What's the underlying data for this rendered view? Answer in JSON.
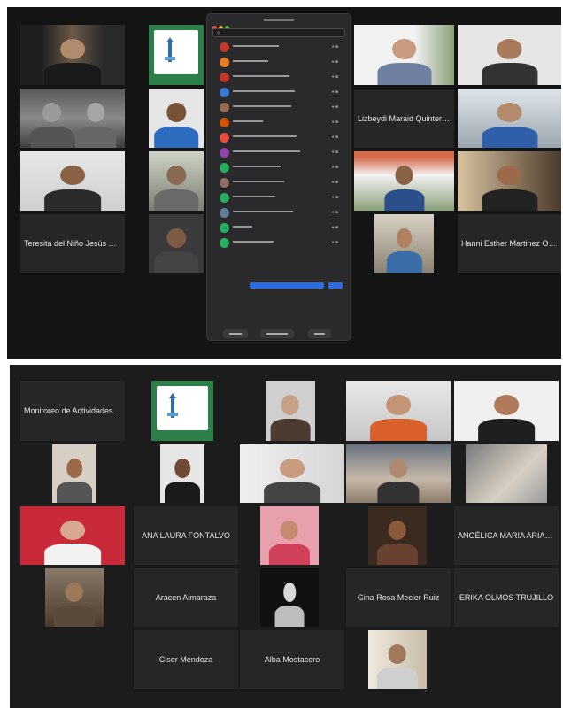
{
  "screenshot_top": {
    "panel": {
      "rows": [
        {
          "avatar_color": "#c0392b"
        },
        {
          "avatar_color": "#e67e22"
        },
        {
          "avatar_color": "#c0392b"
        },
        {
          "avatar_color": "#3a7bd5"
        },
        {
          "avatar_color": "#9b6b4e"
        },
        {
          "avatar_color": "#d35400"
        },
        {
          "avatar_color": "#e74c3c"
        },
        {
          "avatar_color": "#8e44ad"
        },
        {
          "avatar_color": "#27ae60"
        },
        {
          "avatar_color": "#8d6e63"
        },
        {
          "avatar_color": "#27ae60"
        },
        {
          "avatar_color": "#5d7d9a"
        },
        {
          "avatar_color": "#27ae60"
        },
        {
          "avatar_color": "#27ae60"
        }
      ],
      "accent": "#2d6cdf"
    },
    "tiles": {
      "t1_label": "Lizbeydi Maraid Quintero C...",
      "t2_label": "Teresita del Niño Jesús Pa...",
      "t3_label": "Hanni Esther Martinez Osuna"
    }
  },
  "screenshot_bottom": {
    "tiles": {
      "b1_label": "Monitoreo de Actividades T...",
      "b2_label": "ANA LAURA FONTALVO",
      "b3_label": "ANGÉLICA MARIA ARIAS LOZANO",
      "b4_label": "Aracen Almaraza",
      "b5_label": "Gina Rosa Mecler Ruiz",
      "b6_label": "ERIKA OLMOS TRUJILLO",
      "b7_label": "Ciser Mendoza",
      "b8_label": "Alba Mostacero"
    }
  },
  "colors": {
    "background": "#141414",
    "tile": "#262626",
    "logo_green": "#2d7f4a"
  }
}
